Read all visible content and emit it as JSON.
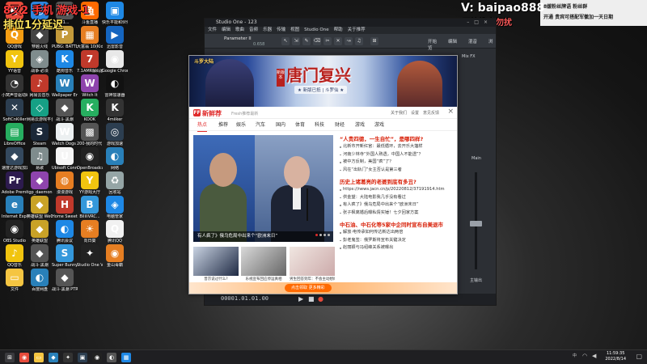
{
  "overlays": {
    "top_left_line1": "8又2  手机  游戏-1",
    "top_left_line2": "排位1分延迟",
    "watermark": "V: baipao888",
    "watermark_sub": "不接推广勿扰",
    "bubble_text": "开通  贵宾可搭配军徽加一天日期"
  },
  "chatbar": {
    "line1": "8媛粉丝牌语  粉丝群",
    "line2": "开通  贵宾可搭配军徽加一天日期"
  },
  "desktop_icons": [
    {
      "label": "",
      "color": "#e74c3c",
      "glyph": "●"
    },
    {
      "label": "",
      "color": "#2e86de",
      "glyph": "◎"
    },
    {
      "label": "11...",
      "color": "#555",
      "glyph": "▤"
    },
    {
      "label": "斗鱼直播",
      "color": "#ff6a00",
      "glyph": "鱼"
    },
    {
      "label": "快乐平能和伙伴",
      "color": "#1e88e5",
      "glyph": "▣"
    },
    {
      "label": "QQ游戏",
      "color": "#f39c12",
      "glyph": "Q"
    },
    {
      "label": "穿越火线",
      "color": "#444",
      "glyph": "◆"
    },
    {
      "label": "PUBG: BATTLEGR...",
      "color": "#c49a3a",
      "glyph": "P"
    },
    {
      "label": "大富翁 10(Kids...",
      "color": "#e67e22",
      "glyph": "▦"
    },
    {
      "label": "迅雷影音",
      "color": "#1565c0",
      "glyph": "▶"
    },
    {
      "label": "YY语音",
      "color": "#f1c40f",
      "glyph": "Y"
    },
    {
      "label": "战争·必须",
      "color": "#7f8c8d",
      "glyph": "◈"
    },
    {
      "label": "酷狗音乐",
      "color": "#1e88e5",
      "glyph": "K"
    },
    {
      "label": "7.1AMR解码器",
      "color": "#c0392b",
      "glyph": "7"
    },
    {
      "label": "Google Chrome",
      "color": "#e8e8e8",
      "glyph": "◉"
    },
    {
      "label": "小窝声音驱动助手",
      "color": "#333",
      "glyph": "◔"
    },
    {
      "label": "网易云音乐",
      "color": "#c0392b",
      "glyph": "♪"
    },
    {
      "label": "Wallpaper Engine",
      "color": "#2980b9",
      "glyph": "W"
    },
    {
      "label": "Witch It",
      "color": "#8e44ad",
      "glyph": "W"
    },
    {
      "label": "雷神加速器",
      "color": "#111",
      "glyph": "◐"
    },
    {
      "label": "SoftCnKiller",
      "color": "#2c3e50",
      "glyph": "✕"
    },
    {
      "label": "网易云游戏平台",
      "color": "#16a085",
      "glyph": "◇"
    },
    {
      "label": "战斗·黑潮",
      "color": "#555",
      "glyph": "◆"
    },
    {
      "label": "KOOK",
      "color": "#27ae60",
      "glyph": "K"
    },
    {
      "label": "4miiker",
      "color": "#333",
      "glyph": "K"
    },
    {
      "label": "LibreOffice",
      "color": "#27ae60",
      "glyph": "▤"
    },
    {
      "label": "Steam",
      "color": "#1b2838",
      "glyph": "S"
    },
    {
      "label": "Watch Dogs 2",
      "color": "#ecf0f1",
      "glyph": "W"
    },
    {
      "label": "200·我的时代 7.0",
      "color": "#555",
      "glyph": "▩"
    },
    {
      "label": "游戏加速",
      "color": "#2c3e50",
      "glyph": "◎"
    },
    {
      "label": "速度达游戏加速器",
      "color": "#34495e",
      "glyph": "◆"
    },
    {
      "label": "易歌",
      "color": "#7f8c8d",
      "glyph": "♫"
    },
    {
      "label": "Ubisoft Connect",
      "color": "#f5f5f5",
      "glyph": "U"
    },
    {
      "label": "OpenBroadcaster...",
      "color": "#222",
      "glyph": "◉"
    },
    {
      "label": "网络",
      "color": "#2980b9",
      "glyph": "◐"
    },
    {
      "label": "Adobe Premiere...",
      "color": "#2d1b4e",
      "glyph": "Pr"
    },
    {
      "label": "tgp_daemon",
      "color": "#8e44ad",
      "glyph": "◆"
    },
    {
      "label": "漫漫游戏",
      "color": "#e67e22",
      "glyph": "◍"
    },
    {
      "label": "YY游戏大厅",
      "color": "#f1c40f",
      "glyph": "Y"
    },
    {
      "label": "回收站",
      "color": "#95a5a6",
      "glyph": "♻"
    },
    {
      "label": "Internet Explorer",
      "color": "#2980b9",
      "glyph": "e"
    },
    {
      "label": "英雄联盟 WeGame版",
      "color": "#c9a227",
      "glyph": "◆"
    },
    {
      "label": "Home Sweet...",
      "color": "#c0392b",
      "glyph": "H"
    },
    {
      "label": "BililiVRC...",
      "color": "#3498db",
      "glyph": "B"
    },
    {
      "label": "电脑管家",
      "color": "#1e88e5",
      "glyph": "◈"
    },
    {
      "label": "OBS Studio",
      "color": "#222",
      "glyph": "◉"
    },
    {
      "label": "英雄联盟",
      "color": "#c9a227",
      "glyph": "◆"
    },
    {
      "label": "腾讯会议",
      "color": "#1e88e5",
      "glyph": "◐"
    },
    {
      "label": "向日葵",
      "color": "#e67e22",
      "glyph": "☀"
    },
    {
      "label": "腾讯QQ",
      "color": "#f1f1f1",
      "glyph": "Q"
    },
    {
      "label": "QQ音乐",
      "color": "#f1c40f",
      "glyph": "♪"
    },
    {
      "label": "战斗·黑潮",
      "color": "#555",
      "glyph": "◆"
    },
    {
      "label": "Super Bunny Man",
      "color": "#3498db",
      "glyph": "S"
    },
    {
      "label": "Studio One V3.5...",
      "color": "#222",
      "glyph": "✦"
    },
    {
      "label": "金山毒霸",
      "color": "#e67e22",
      "glyph": "◉"
    },
    {
      "label": "文件",
      "color": "#f5c542",
      "glyph": "▭"
    },
    {
      "label": "百度网盘",
      "color": "#2980b9",
      "glyph": "◐"
    },
    {
      "label": "战斗·黑潮 PTR",
      "color": "#555",
      "glyph": "◆"
    }
  ],
  "studio": {
    "title": "Studio One - 123",
    "menu": [
      "文件",
      "编辑",
      "歌曲",
      "音频",
      "乐器",
      "传输",
      "视图",
      "Studio One",
      "帮助",
      "关于推荐"
    ],
    "track_title": "Parameter II",
    "track_sub": "0.658",
    "toolbar_right": [
      "开始",
      "编辑",
      "混音",
      "浏览"
    ],
    "ruler_label": "Mix FX",
    "mixer_label_out": "主输出",
    "mixer_label_main": "Main",
    "timecode": "00001.01.01.00"
  },
  "popup": {
    "banner": {
      "logo": "斗罗大陆",
      "title": "唐门复兴",
      "tag": "新版本",
      "subtitle": "★ 新版已抵 | 斗罗仙 ★"
    },
    "brand": "新鲜荐",
    "slogan": "Fresh推荐最新",
    "header_links": [
      "关于我们",
      "设置",
      "意见反馈"
    ],
    "close": "×",
    "tabs": [
      "热点",
      "推荐",
      "娱乐",
      "汽车",
      "国内",
      "体育",
      "科技",
      "财经",
      "游戏",
      "游戏"
    ],
    "active_tab": 0,
    "hero_caption": "有人疯了》俄乌危局中出来个“欧洲末日”",
    "news": [
      {
        "type": "red",
        "text": "“人贵四德，一生自忙”，是哪四样?"
      },
      {
        "type": "item",
        "text": "北新市开新红官：最低循环，去开乐大篷样"
      },
      {
        "type": "item",
        "text": "河南少林寺“外国人熟透，中国人不能透”？"
      },
      {
        "type": "item",
        "text": "被中方反制，美国“疯”了？"
      },
      {
        "type": "item",
        "text": "风在“出轨门”女主否认是第三者"
      },
      {
        "type": "gap",
        "text": ""
      },
      {
        "type": "red",
        "text": "历史上诸葛亮的老婆到底有多丑?"
      },
      {
        "type": "item",
        "text": "https://news.jacn.cn/p/20220812/37191914.htm"
      },
      {
        "type": "item",
        "text": "供金望：大陆电影我几乎没有看过"
      },
      {
        "type": "item",
        "text": "有人疯了》俄乌危局中出来个“欧洲末日”"
      },
      {
        "type": "item",
        "text": "张子枫离婚后曝私情实锤！七夕回家方案"
      },
      {
        "type": "gap",
        "text": ""
      },
      {
        "type": "red",
        "text": "中石油、中石化等5家中企同时宣布自美退市"
      },
      {
        "type": "item",
        "text": "解放·电传承如何传达新达出两倍"
      },
      {
        "type": "item",
        "text": "彭老鬼签：俄罗斯将宣布关键决定"
      },
      {
        "type": "item",
        "text": "赵丽颖与冯绍峰关系被曝出"
      }
    ],
    "thumbs": [
      {
        "caption": "普京说过什么?",
        "c1": "#c9d3e2",
        "c2": "#1f2a44"
      },
      {
        "caption": "乐视宣布回应停运真相",
        "c1": "#d9d9d9",
        "c2": "#666"
      },
      {
        "caption": "男生回答到年：不会主动想结婚",
        "c1": "#f0e6e1",
        "c2": "#caa"
      }
    ],
    "promo": "点击领取 更多精彩"
  },
  "taskbar": {
    "icons": [
      {
        "name": "windows-start-icon",
        "glyph": "⊞",
        "color": "#3a3a3e"
      },
      {
        "name": "chrome-icon",
        "glyph": "◉",
        "color": "#e74c3c"
      },
      {
        "name": "file-explorer-icon",
        "glyph": "▭",
        "color": "#f5c542"
      },
      {
        "name": "tencent-icon",
        "glyph": "◆",
        "color": "#2980b9"
      },
      {
        "name": "studio-one-taskbar-icon",
        "glyph": "✦",
        "color": "#333"
      },
      {
        "name": "app-icon",
        "glyph": "▣",
        "color": "#2c3e50"
      },
      {
        "name": "obs-taskbar-icon",
        "glyph": "◉",
        "color": "#222"
      },
      {
        "name": "app-icon-2",
        "glyph": "◐",
        "color": "#555"
      },
      {
        "name": "app-icon-3",
        "glyph": "▦",
        "color": "#1e88e5"
      }
    ],
    "tray_text": "中",
    "time": "11:59:35",
    "date": "2022/8/14"
  }
}
